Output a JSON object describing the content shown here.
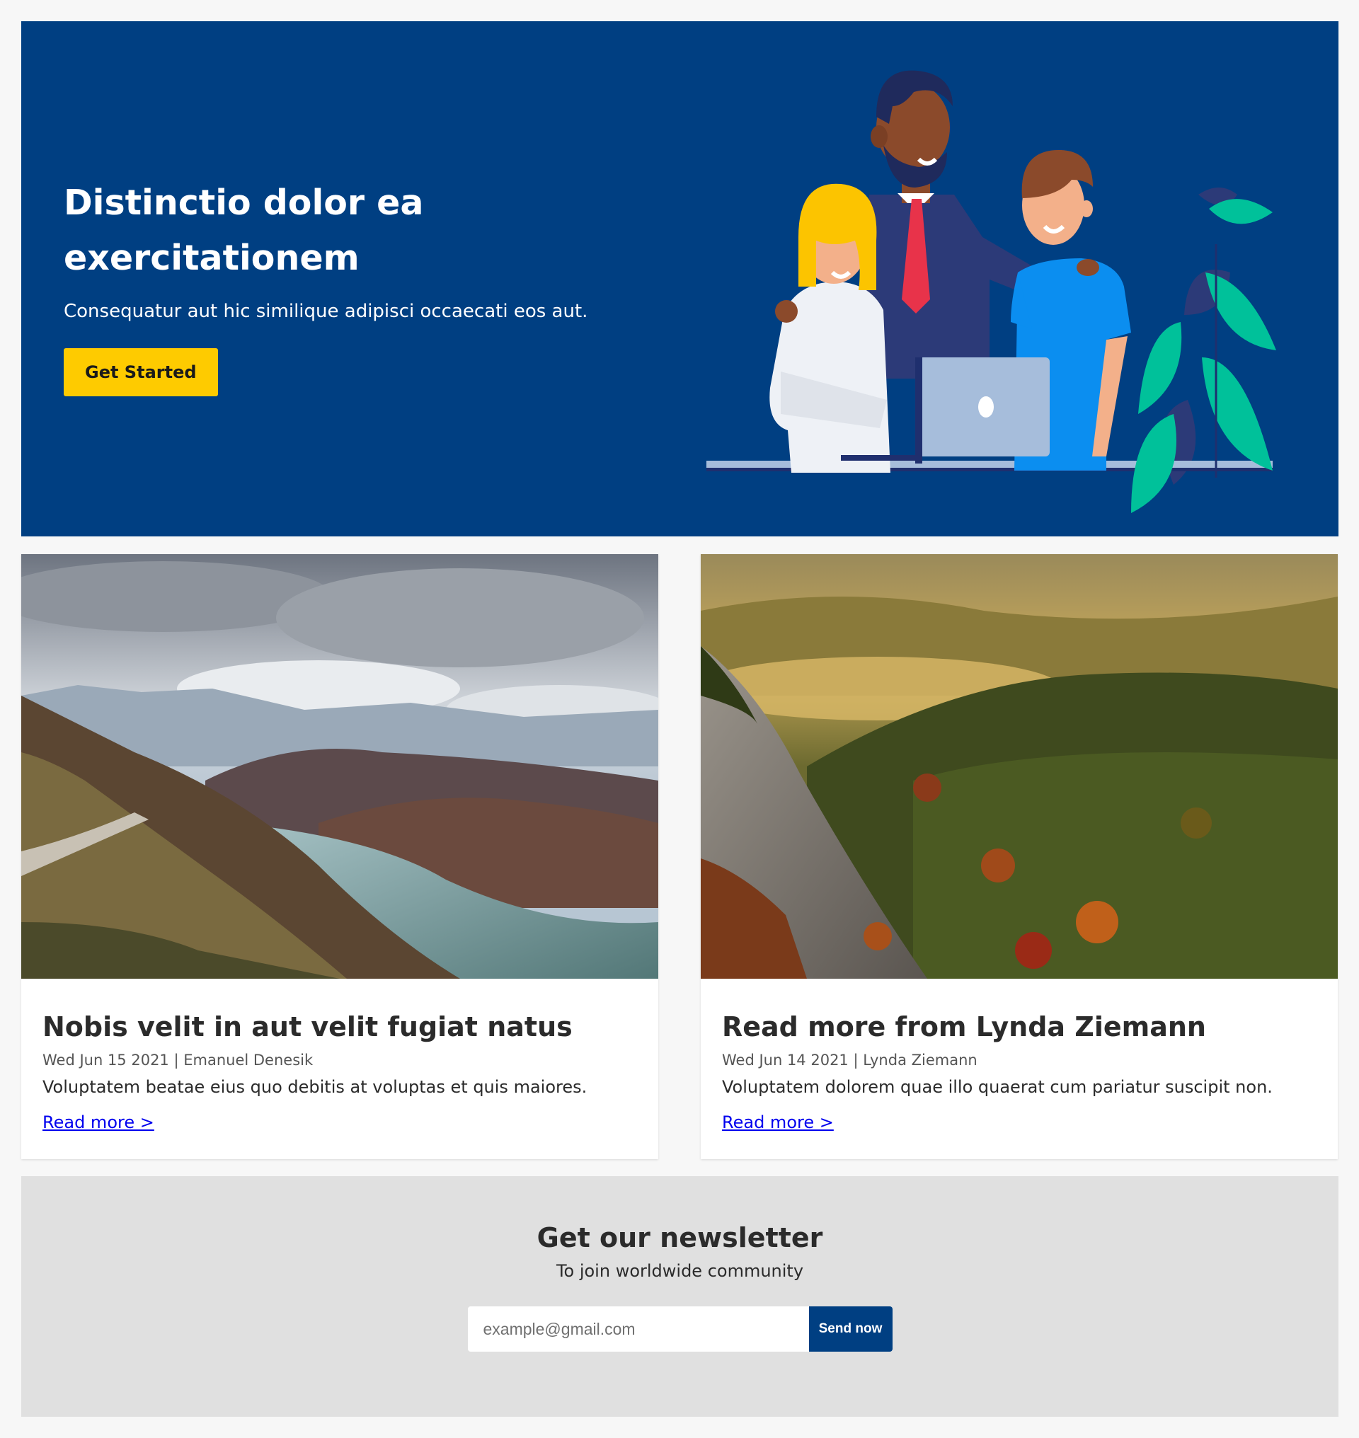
{
  "hero": {
    "title": "Distinctio dolor ea exercitationem",
    "subtitle": "Consequatur aut hic similique adipisci occaecati eos aut.",
    "cta_label": "Get Started",
    "illustration": "team-at-laptop-illustration"
  },
  "posts": [
    {
      "image": "mountain-lake-photo",
      "title": "Nobis velit in aut velit fugiat natus",
      "date": "Wed Jun 15 2021",
      "separator": " | ",
      "author": "Emanuel Denesik",
      "excerpt": "Voluptatem beatae eius quo debitis at voluptas et quis maiores.",
      "link_label": "Read more >"
    },
    {
      "image": "forest-cliff-photo",
      "title": "Read more from Lynda Ziemann",
      "date": "Wed Jun 14 2021",
      "separator": " | ",
      "author": "Lynda Ziemann",
      "excerpt": "Voluptatem dolorem quae illo quaerat cum pariatur suscipit non.",
      "link_label": "Read more >"
    }
  ],
  "newsletter": {
    "title": "Get our newsletter",
    "subtitle": "To join worldwide community",
    "email_placeholder": "example@gmail.com",
    "send_label": "Send now"
  },
  "colors": {
    "hero_bg": "#003f82",
    "accent_yellow": "#fecb00",
    "link_blue": "#0000ee",
    "newsletter_bg": "#e0e0e0"
  }
}
